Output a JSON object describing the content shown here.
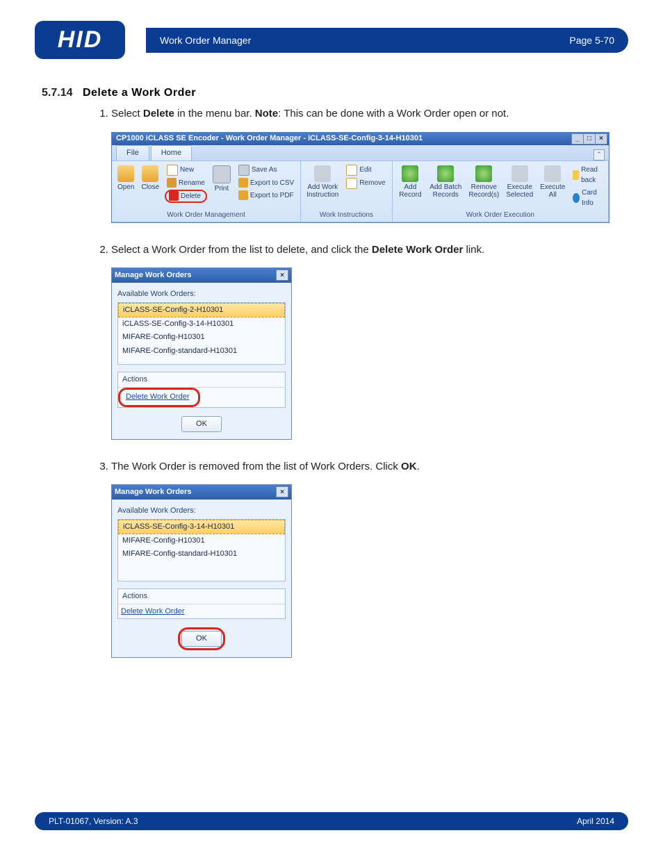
{
  "logo": "HID",
  "header": {
    "left": "Work Order Manager",
    "right": "Page 5-70"
  },
  "section": {
    "number": "5.7.14",
    "title": "Delete a Work Order"
  },
  "steps": {
    "s1a": "Select ",
    "s1b": "Delete",
    "s1c": " in the menu bar. ",
    "s1d": "Note",
    "s1e": ": This can be done with a Work Order open or not.",
    "s2a": "Select a Work Order from the list to delete, and click the ",
    "s2b": "Delete Work Order",
    "s2c": " link.",
    "s3a": "The Work Order is removed from the list of Work Orders. Click ",
    "s3b": "OK",
    "s3c": "."
  },
  "ribbon": {
    "title": "CP1000 iCLASS SE Encoder - Work Order Manager - iCLASS-SE-Config-3-14-H10301",
    "tabs": {
      "file": "File",
      "home": "Home"
    },
    "open": "Open",
    "close": "Close",
    "new": "New",
    "rename": "Rename",
    "delete": "Delete",
    "print": "Print",
    "saveas": "Save As",
    "exportcsv": "Export to CSV",
    "exportpdf": "Export to PDF",
    "addwi": "Add Work\nInstruction",
    "edit": "Edit",
    "remove": "Remove",
    "addrec": "Add Record",
    "addbatch": "Add Batch\nRecords",
    "remrec": "Remove\nRecord(s)",
    "execsel": "Execute\nSelected",
    "execall": "Execute\nAll",
    "readback": "Read back",
    "cardinfo": "Card Info",
    "g1": "Work Order Management",
    "g2": "Work Instructions",
    "g3": "Work Order Execution"
  },
  "dlg1": {
    "title": "Manage Work Orders",
    "avail": "Available Work Orders:",
    "items": [
      "iCLASS-SE-Config-2-H10301",
      "iCLASS-SE-Config-3-14-H10301",
      "MIFARE-Config-H10301",
      "MIFARE-Config-standard-H10301"
    ],
    "actions": "Actions",
    "delete": "Delete Work Order",
    "ok": "OK"
  },
  "dlg2": {
    "title": "Manage Work Orders",
    "avail": "Available Work Orders:",
    "items": [
      "iCLASS-SE-Config-3-14-H10301",
      "MIFARE-Config-H10301",
      "MIFARE-Config-standard-H10301"
    ],
    "actions": "Actions",
    "delete": "Delete Work Order",
    "ok": "OK"
  },
  "footer": {
    "left": "PLT-01067, Version: A.3",
    "right": "April 2014"
  }
}
